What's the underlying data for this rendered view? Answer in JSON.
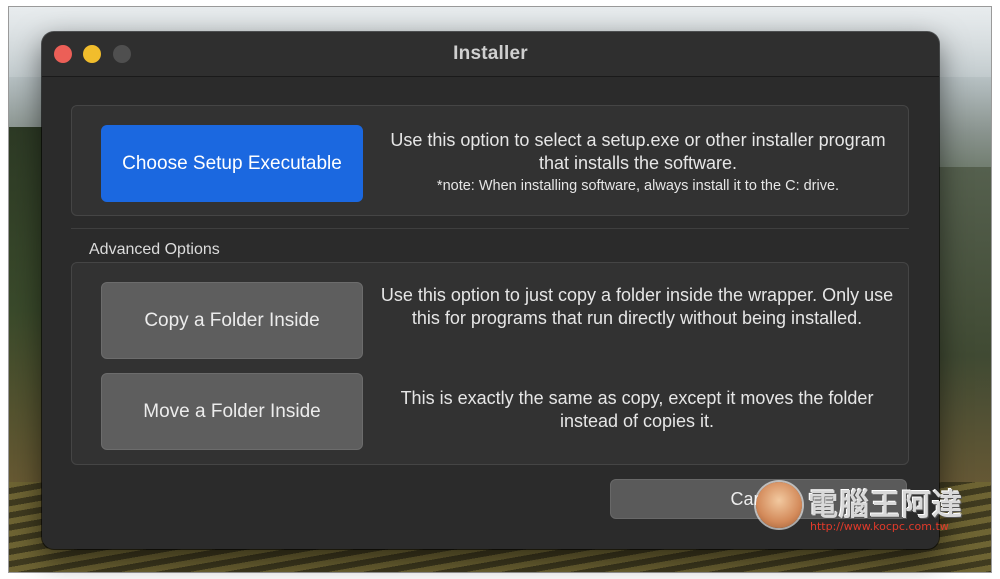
{
  "window": {
    "title": "Installer"
  },
  "primary": {
    "button_label": "Choose Setup Executable",
    "description": "Use this option to select a setup.exe or other installer program that installs the software.",
    "note": "*note: When installing software, always install it to the C: drive."
  },
  "advanced": {
    "label": "Advanced Options",
    "copy_button": "Copy a Folder Inside",
    "copy_description": "Use this option to just copy a folder inside the wrapper. Only use this for programs that run directly without being installed.",
    "move_button": "Move a Folder Inside",
    "move_description": "This is exactly the same as copy, except it moves the folder instead of copies it."
  },
  "footer": {
    "cancel_label": "Cancel"
  },
  "watermark": {
    "text": "電腦王阿達",
    "url": "http://www.kocpc.com.tw"
  },
  "colors": {
    "primary_button": "#1b68e0",
    "window_bg": "#2b2b2b",
    "close": "#ec5f57",
    "minimize": "#f1bd2c"
  },
  "icons": [
    "close-traffic-light",
    "minimize-traffic-light",
    "zoom-traffic-light"
  ]
}
